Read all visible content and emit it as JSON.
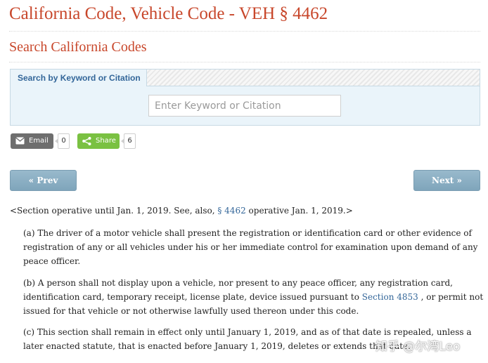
{
  "page": {
    "title": "California Code, Vehicle Code - VEH § 4462",
    "subtitle": "Search California Codes"
  },
  "search": {
    "tab_label": "Search by Keyword or Citation",
    "placeholder": "Enter Keyword or Citation"
  },
  "share": {
    "email_label": "Email",
    "email_count": "0",
    "share_label": "Share",
    "share_count": "6"
  },
  "nav": {
    "prev_label": "« Prev",
    "next_label": "Next »"
  },
  "note": {
    "prefix": "<Section operative until Jan. 1, 2019.   See, also, ",
    "link": "§  4462",
    "suffix": " operative Jan. 1, 2019.>"
  },
  "sections": {
    "a": "(a)  The driver of a motor vehicle shall present the registration or identification card or other evidence of registration of any or all vehicles under his or her immediate control for examination upon demand of any peace officer.",
    "b_before": "(b)  A person shall not display upon a vehicle, nor present to any peace officer, any registration card, identification card, temporary receipt, license plate, device issued pursuant to ",
    "b_link": "Section 4853",
    "b_after": " , or permit not issued for that vehicle or not otherwise lawfully used thereon under this code.",
    "c": "(c)  This section shall remain in effect only until January 1, 2019, and as of that date is repealed, unless a later enacted statute, that is enacted before January 1, 2019, deletes or extends that date."
  },
  "watermark": "知乎 @尔湾Leo",
  "colors": {
    "heading": "#c8472b",
    "link": "#336699",
    "nav_button": "#8fb0c4",
    "share_green": "#7ac142",
    "email_gray": "#6e6e6e",
    "panel_bg": "#eaf4fa"
  },
  "icons": {
    "email": "envelope-icon",
    "share": "share-icon"
  }
}
